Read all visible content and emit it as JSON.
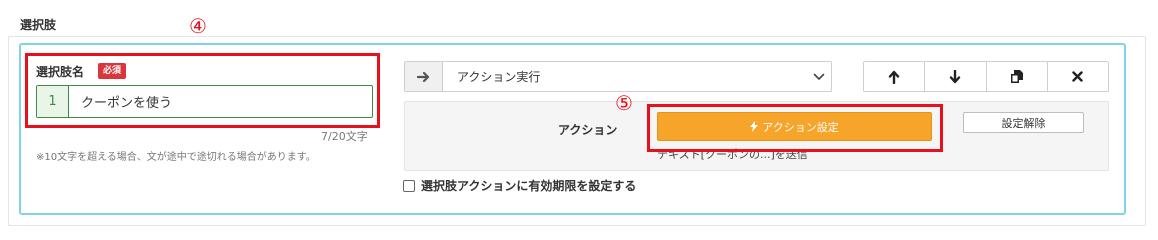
{
  "section": {
    "title": "選択肢"
  },
  "annotations": {
    "num4": "④",
    "num5": "⑤"
  },
  "choice": {
    "name_label": "選択肢名",
    "required_badge": "必須",
    "index": "1",
    "name_value": "クーポンを使う",
    "char_count": "7/20文字",
    "note": "※10文字を超える場合、文が途中で途切れる場合があります。"
  },
  "action_select": {
    "addon_icon": "arrow-right-icon",
    "value": "アクション実行"
  },
  "toolbar": {
    "buttons": [
      "arrow-up-icon",
      "arrow-down-icon",
      "copy-icon",
      "delete-icon"
    ]
  },
  "action_panel": {
    "label": "アクション",
    "settings_button": "アクション設定",
    "clear_button": "設定解除",
    "description": "テキスト[クーポンの...]を送信"
  },
  "expiry": {
    "label": "選択肢アクションに有効期限を設定する",
    "checked": false
  },
  "colors": {
    "accent_red": "#e8101a",
    "card_border": "#7fd4e6",
    "primary_orange": "#f7a52a",
    "input_green": "#3c8a4a"
  }
}
